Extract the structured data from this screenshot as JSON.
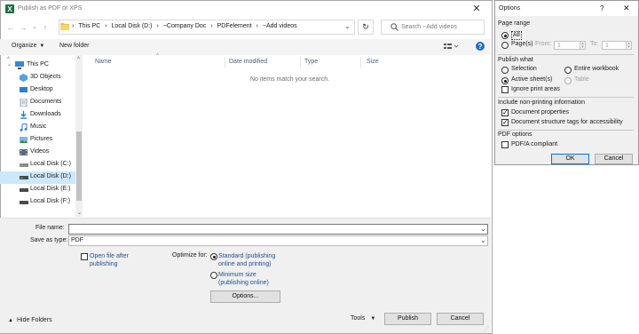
{
  "main_dialog": {
    "title": "Publish as PDF or XPS",
    "close_glyph": "✕",
    "address": {
      "crumbs": [
        "This PC",
        "Local Disk (D:)",
        "~Company Doc",
        "PDFelement",
        "~Add videos"
      ],
      "separator": "›"
    },
    "search_placeholder": "Search ~Add videos",
    "toolbar": {
      "organize_label": "Organize",
      "new_folder_label": "New folder"
    },
    "nav_items": [
      {
        "label": "This PC",
        "icon": "computer-icon"
      },
      {
        "label": "3D Objects",
        "icon": "cube-icon"
      },
      {
        "label": "Desktop",
        "icon": "desktop-icon"
      },
      {
        "label": "Documents",
        "icon": "documents-icon"
      },
      {
        "label": "Downloads",
        "icon": "download-icon"
      },
      {
        "label": "Music",
        "icon": "music-icon"
      },
      {
        "label": "Pictures",
        "icon": "pictures-icon"
      },
      {
        "label": "Videos",
        "icon": "videos-icon"
      },
      {
        "label": "Local Disk (C:)",
        "icon": "drive-icon"
      },
      {
        "label": "Local Disk (D:)",
        "icon": "drive-icon",
        "selected": true
      },
      {
        "label": "Local Disk (E:)",
        "icon": "drive-icon"
      },
      {
        "label": "Local Disk (F:)",
        "icon": "drive-icon"
      }
    ],
    "columns": [
      "Name",
      "Date modified",
      "Type",
      "Size"
    ],
    "empty_message": "No items match your search.",
    "file_name_label": "File name:",
    "file_name_value": "",
    "save_as_type_label": "Save as type:",
    "save_as_type_value": "PDF",
    "open_after_label": "Open file after publishing",
    "open_after_checked": false,
    "optimize_label": "Optimize for:",
    "optimize_options": [
      {
        "label": "Standard (publishing online and printing)",
        "selected": true
      },
      {
        "label": "Minimum size (publishing online)",
        "selected": false
      }
    ],
    "options_button": "Options...",
    "hide_folders_label": "Hide Folders",
    "tools_label": "Tools",
    "publish_button": "Publish",
    "cancel_button": "Cancel"
  },
  "options_dialog": {
    "title": "Options",
    "help_glyph": "?",
    "close_glyph": "✕",
    "page_range": {
      "heading": "Page range",
      "all_label": "All",
      "pages_label": "Page(s)",
      "from_label": "From:",
      "from_value": "1",
      "to_label": "To:",
      "to_value": "1",
      "selected": "All"
    },
    "publish_what": {
      "heading": "Publish what",
      "options": [
        {
          "label": "Selection",
          "selected": false,
          "disabled": false
        },
        {
          "label": "Entire workbook",
          "selected": false,
          "disabled": false
        },
        {
          "label": "Active sheet(s)",
          "selected": true,
          "disabled": false
        },
        {
          "label": "Table",
          "selected": false,
          "disabled": true
        }
      ],
      "ignore_print_areas_label": "Ignore print areas",
      "ignore_print_areas_checked": false
    },
    "non_printing": {
      "heading": "Include non-printing information",
      "document_properties_label": "Document properties",
      "document_properties_checked": true,
      "structure_tags_label": "Document structure tags for accessibility",
      "structure_tags_checked": true
    },
    "pdf_options": {
      "heading": "PDF options",
      "pdfa_label": "PDF/A compliant",
      "pdfa_checked": false
    },
    "ok_button": "OK",
    "cancel_button": "Cancel"
  },
  "colors": {
    "accent": "#0078d7",
    "selection": "#cce8ff",
    "link_blue": "#1f4e8c",
    "excel_green": "#1d6f42"
  }
}
